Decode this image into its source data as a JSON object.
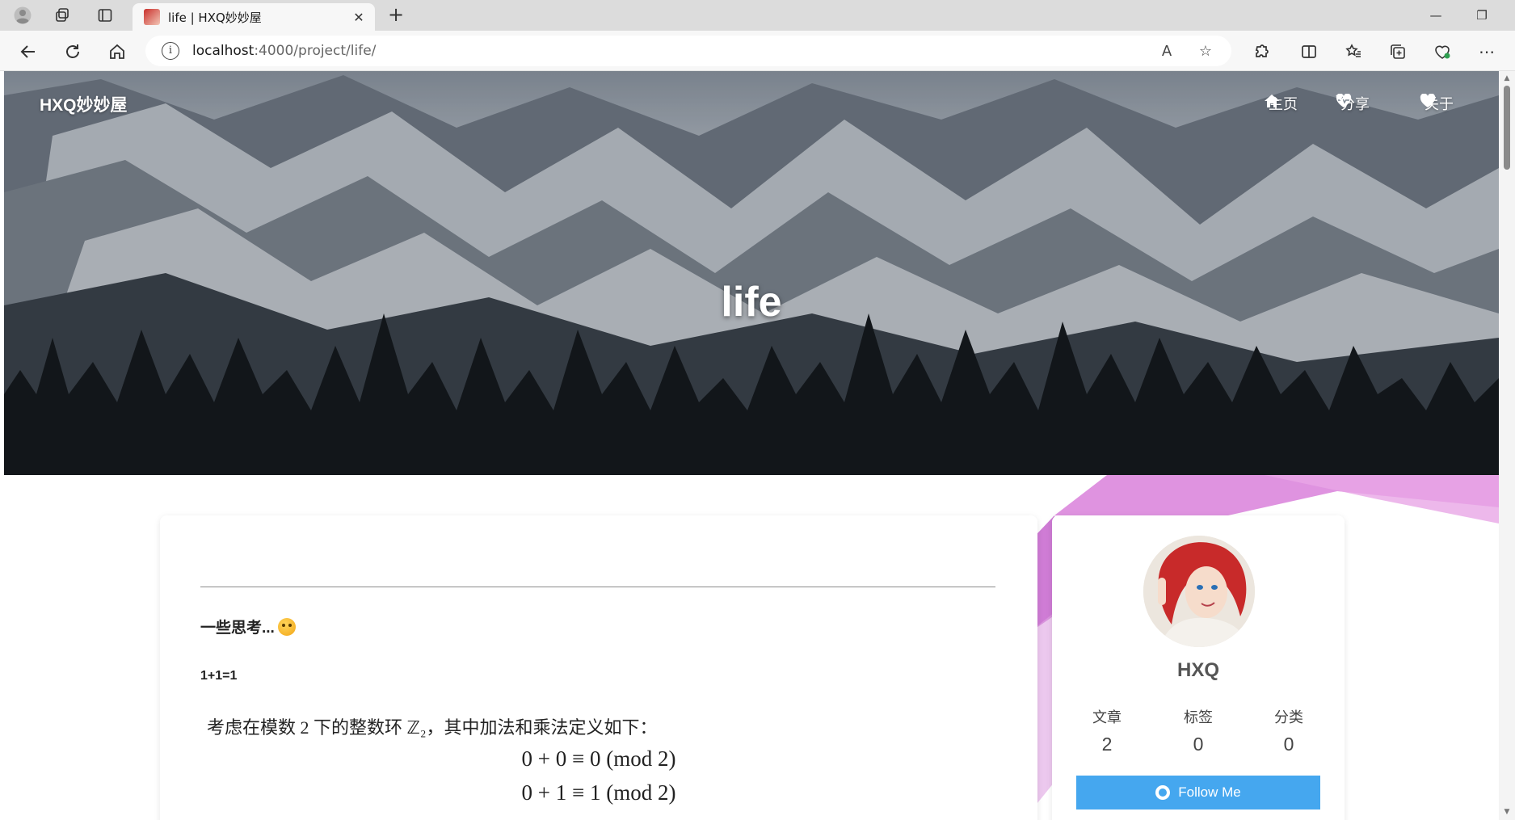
{
  "browser": {
    "tab_title": "life | HXQ妙妙屋",
    "url_host": "localhost",
    "url_path": ":4000/project/life/"
  },
  "site": {
    "title": "HXQ妙妙屋",
    "nav": [
      {
        "label": "主页",
        "icon": "home-icon"
      },
      {
        "label": "分享",
        "icon": "heartbeat-icon",
        "has_dropdown": true
      },
      {
        "label": "关于",
        "icon": "heart-icon"
      }
    ],
    "hero_title": "life"
  },
  "post": {
    "heading": "一些思考...",
    "subheading": "1+1=1",
    "intro": "考虑在模数 2 下的整数环 ℤ₂，其中加法和乘法定义如下：",
    "equations": [
      "0 + 0 ≡ 0   (mod 2)",
      "0 + 1 ≡ 1   (mod 2)"
    ]
  },
  "profile": {
    "name": "HXQ",
    "stats": [
      {
        "label": "文章",
        "value": "2"
      },
      {
        "label": "标签",
        "value": "0"
      },
      {
        "label": "分类",
        "value": "0"
      }
    ],
    "follow_label": "Follow Me"
  },
  "colors": {
    "accent": "#45a7ef",
    "deco": "#d46fd6"
  }
}
